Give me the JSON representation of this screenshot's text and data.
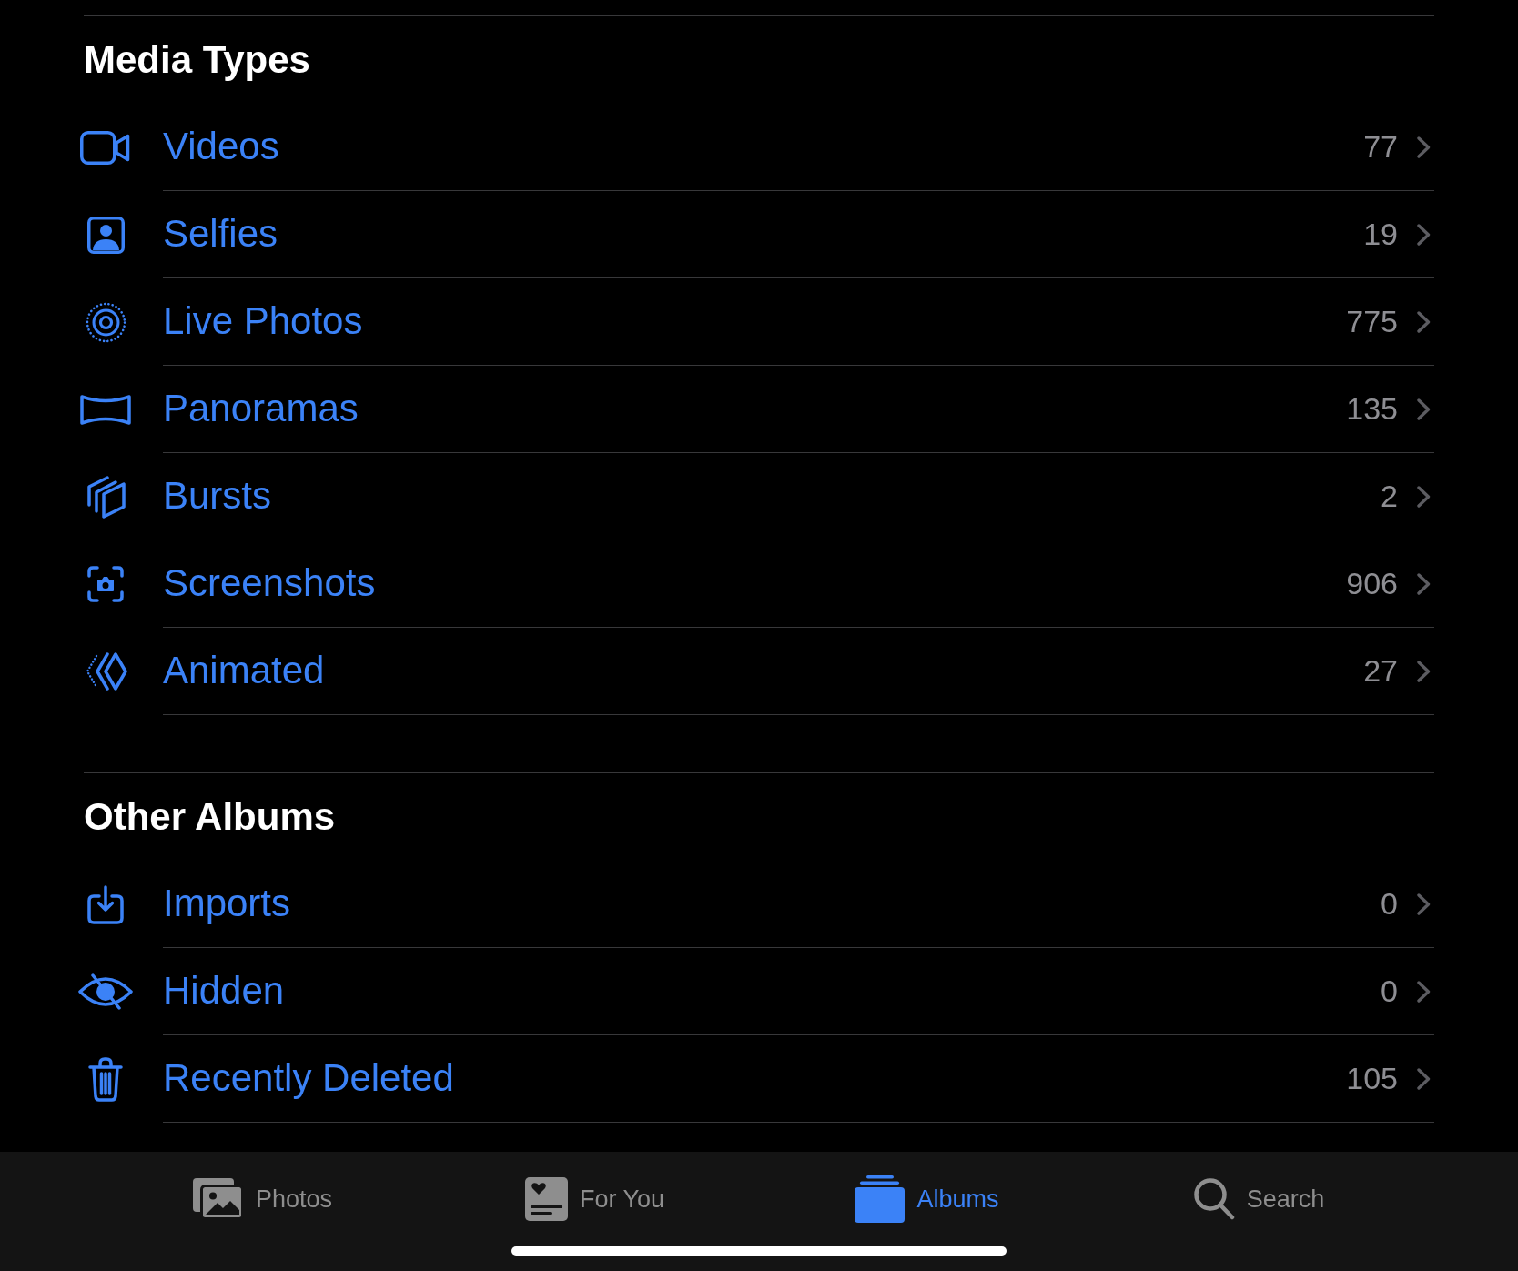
{
  "sections": [
    {
      "title": "Media Types",
      "items": [
        {
          "label": "Videos",
          "count": "77"
        },
        {
          "label": "Selfies",
          "count": "19"
        },
        {
          "label": "Live Photos",
          "count": "775"
        },
        {
          "label": "Panoramas",
          "count": "135"
        },
        {
          "label": "Bursts",
          "count": "2"
        },
        {
          "label": "Screenshots",
          "count": "906"
        },
        {
          "label": "Animated",
          "count": "27"
        }
      ]
    },
    {
      "title": "Other Albums",
      "items": [
        {
          "label": "Imports",
          "count": "0"
        },
        {
          "label": "Hidden",
          "count": "0"
        },
        {
          "label": "Recently Deleted",
          "count": "105"
        }
      ]
    }
  ],
  "tab_bar": {
    "tabs": [
      {
        "label": "Photos",
        "selected": false
      },
      {
        "label": "For You",
        "selected": false
      },
      {
        "label": "Albums",
        "selected": true
      },
      {
        "label": "Search",
        "selected": false
      }
    ]
  }
}
